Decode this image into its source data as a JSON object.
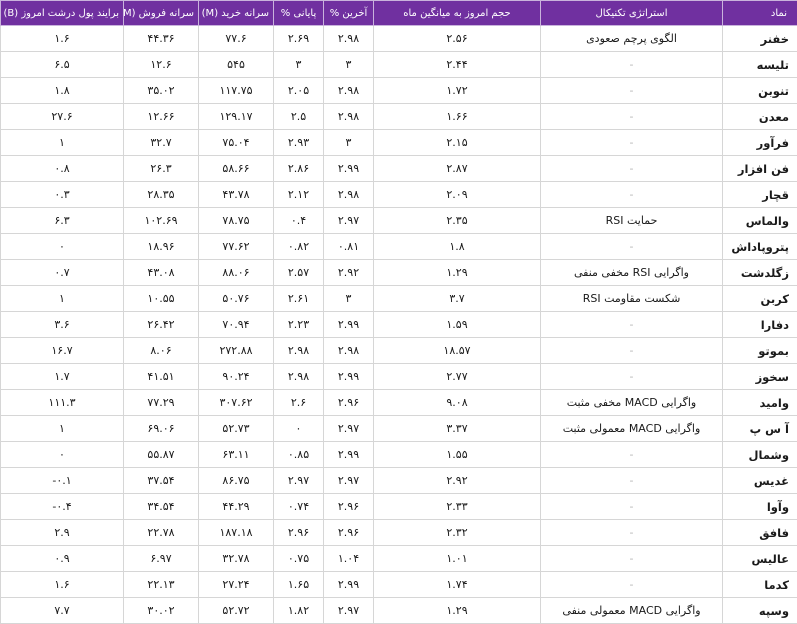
{
  "headers": {
    "symbol": "نماد",
    "strategy": "استراتژی تکنیکال",
    "volume_ratio": "حجم امروز به میانگین ماه",
    "last_pct": "آخرین %",
    "final_pct": "پایانی %",
    "buy_per_capita": "سرانه خرید (M)",
    "sell_per_capita": "سرانه فروش (M)",
    "real_money_flow": "برایند پول درشت امروز (B)"
  },
  "rows": [
    {
      "symbol": "خفنر",
      "strategy": "الگوی پرچم صعودی",
      "volume_ratio": "۲.۵۶",
      "last_pct": "۲.۹۸",
      "final_pct": "۲.۶۹",
      "buy": "۷۷.۶",
      "sell": "۴۴.۳۶",
      "flow": "۱.۶"
    },
    {
      "symbol": "تلیسه",
      "strategy": "-",
      "volume_ratio": "۲.۴۴",
      "last_pct": "۳",
      "final_pct": "۳",
      "buy": "۵۴۵",
      "sell": "۱۲.۶",
      "flow": "۶.۵"
    },
    {
      "symbol": "تنوبن",
      "strategy": "-",
      "volume_ratio": "۱.۷۲",
      "last_pct": "۲.۹۸",
      "final_pct": "۲.۰۵",
      "buy": "۱۱۷.۷۵",
      "sell": "۳۵.۰۲",
      "flow": "۱.۸"
    },
    {
      "symbol": "معدن",
      "strategy": "-",
      "volume_ratio": "۱.۶۶",
      "last_pct": "۲.۹۸",
      "final_pct": "۲.۵",
      "buy": "۱۲۹.۱۷",
      "sell": "۱۲.۶۶",
      "flow": "۲۷.۶"
    },
    {
      "symbol": "فرآور",
      "strategy": "-",
      "volume_ratio": "۲.۱۵",
      "last_pct": "۳",
      "final_pct": "۲.۹۳",
      "buy": "۷۵.۰۴",
      "sell": "۳۲.۷",
      "flow": "۱"
    },
    {
      "symbol": "فن افزار",
      "strategy": "-",
      "volume_ratio": "۲.۸۷",
      "last_pct": "۲.۹۹",
      "final_pct": "۲.۸۶",
      "buy": "۵۸.۶۶",
      "sell": "۲۶.۳",
      "flow": "۰.۸"
    },
    {
      "symbol": "قچار",
      "strategy": "-",
      "volume_ratio": "۲.۰۹",
      "last_pct": "۲.۹۸",
      "final_pct": "۲.۱۲",
      "buy": "۴۳.۷۸",
      "sell": "۲۸.۳۵",
      "flow": "۰.۳"
    },
    {
      "symbol": "والماس",
      "strategy": "حمایت RSI",
      "volume_ratio": "۲.۳۵",
      "last_pct": "۲.۹۷",
      "final_pct": "۰.۴",
      "buy": "۷۸.۷۵",
      "sell": "۱۰۲.۶۹",
      "flow": "۶.۳"
    },
    {
      "symbol": "پتروپاداش",
      "strategy": "-",
      "volume_ratio": "۱.۸",
      "last_pct": "۰.۸۱",
      "final_pct": "۰.۸۲",
      "buy": "۷۷.۶۲",
      "sell": "۱۸.۹۶",
      "flow": "۰"
    },
    {
      "symbol": "زگلدشت",
      "strategy": "واگرایی RSI مخفی منفی",
      "volume_ratio": "۱.۲۹",
      "last_pct": "۲.۹۲",
      "final_pct": "۲.۵۷",
      "buy": "۸۸.۰۶",
      "sell": "۴۳.۰۸",
      "flow": "۰.۷"
    },
    {
      "symbol": "کربن",
      "strategy": "شکست مقاومت RSI",
      "volume_ratio": "۳.۷",
      "last_pct": "۳",
      "final_pct": "۲.۶۱",
      "buy": "۵۰.۷۶",
      "sell": "۱۰.۵۵",
      "flow": "۱"
    },
    {
      "symbol": "دفارا",
      "strategy": "-",
      "volume_ratio": "۱.۵۹",
      "last_pct": "۲.۹۹",
      "final_pct": "۲.۲۳",
      "buy": "۷۰.۹۴",
      "sell": "۲۶.۴۲",
      "flow": "۳.۶"
    },
    {
      "symbol": "بموتو",
      "strategy": "-",
      "volume_ratio": "۱۸.۵۷",
      "last_pct": "۲.۹۸",
      "final_pct": "۲.۹۸",
      "buy": "۲۷۲.۸۸",
      "sell": "۸.۰۶",
      "flow": "۱۶.۷"
    },
    {
      "symbol": "سخوز",
      "strategy": "-",
      "volume_ratio": "۲.۷۷",
      "last_pct": "۲.۹۹",
      "final_pct": "۲.۹۸",
      "buy": "۹۰.۲۴",
      "sell": "۴۱.۵۱",
      "flow": "۱.۷"
    },
    {
      "symbol": "وامید",
      "strategy": "واگرایی MACD مخفی مثبت",
      "volume_ratio": "۹.۰۸",
      "last_pct": "۲.۹۶",
      "final_pct": "۲.۶",
      "buy": "۳۰۷.۶۲",
      "sell": "۷۷.۲۹",
      "flow": "۱۱۱.۳"
    },
    {
      "symbol": "آ س پ",
      "strategy": "واگرایی MACD معمولی مثبت",
      "volume_ratio": "۳.۳۷",
      "last_pct": "۲.۹۷",
      "final_pct": "۰",
      "buy": "۵۲.۷۳",
      "sell": "۶۹.۰۶",
      "flow": "۱"
    },
    {
      "symbol": "وشمال",
      "strategy": "-",
      "volume_ratio": "۱.۵۵",
      "last_pct": "۲.۹۹",
      "final_pct": "۰.۸۵",
      "buy": "۶۳.۱۱",
      "sell": "۵۵.۸۷",
      "flow": "۰"
    },
    {
      "symbol": "غدیس",
      "strategy": "-",
      "volume_ratio": "۲.۹۲",
      "last_pct": "۲.۹۷",
      "final_pct": "۲.۹۷",
      "buy": "۸۶.۷۵",
      "sell": "۳۷.۵۴",
      "flow": "۰.۱-"
    },
    {
      "symbol": "وآوا",
      "strategy": "-",
      "volume_ratio": "۲.۳۳",
      "last_pct": "۲.۹۶",
      "final_pct": "۰.۷۴",
      "buy": "۴۴.۲۹",
      "sell": "۳۴.۵۴",
      "flow": "۰.۴-"
    },
    {
      "symbol": "فافق",
      "strategy": "-",
      "volume_ratio": "۲.۳۲",
      "last_pct": "۲.۹۶",
      "final_pct": "۲.۹۶",
      "buy": "۱۸۷.۱۸",
      "sell": "۲۲.۷۸",
      "flow": "۲.۹"
    },
    {
      "symbol": "عالیس",
      "strategy": "-",
      "volume_ratio": "۱.۰۱",
      "last_pct": "۱.۰۴",
      "final_pct": "۰.۷۵",
      "buy": "۳۲.۷۸",
      "sell": "۶.۹۷",
      "flow": "۰.۹"
    },
    {
      "symbol": "کدما",
      "strategy": "-",
      "volume_ratio": "۱.۷۴",
      "last_pct": "۲.۹۹",
      "final_pct": "۱.۶۵",
      "buy": "۲۷.۲۴",
      "sell": "۲۲.۱۳",
      "flow": "۱.۶"
    },
    {
      "symbol": "وسپه",
      "strategy": "واگرایی MACD معمولی منفی",
      "volume_ratio": "۱.۲۹",
      "last_pct": "۲.۹۷",
      "final_pct": "۱.۸۲",
      "buy": "۵۲.۷۲",
      "sell": "۳۰.۰۲",
      "flow": "۷.۷"
    }
  ]
}
